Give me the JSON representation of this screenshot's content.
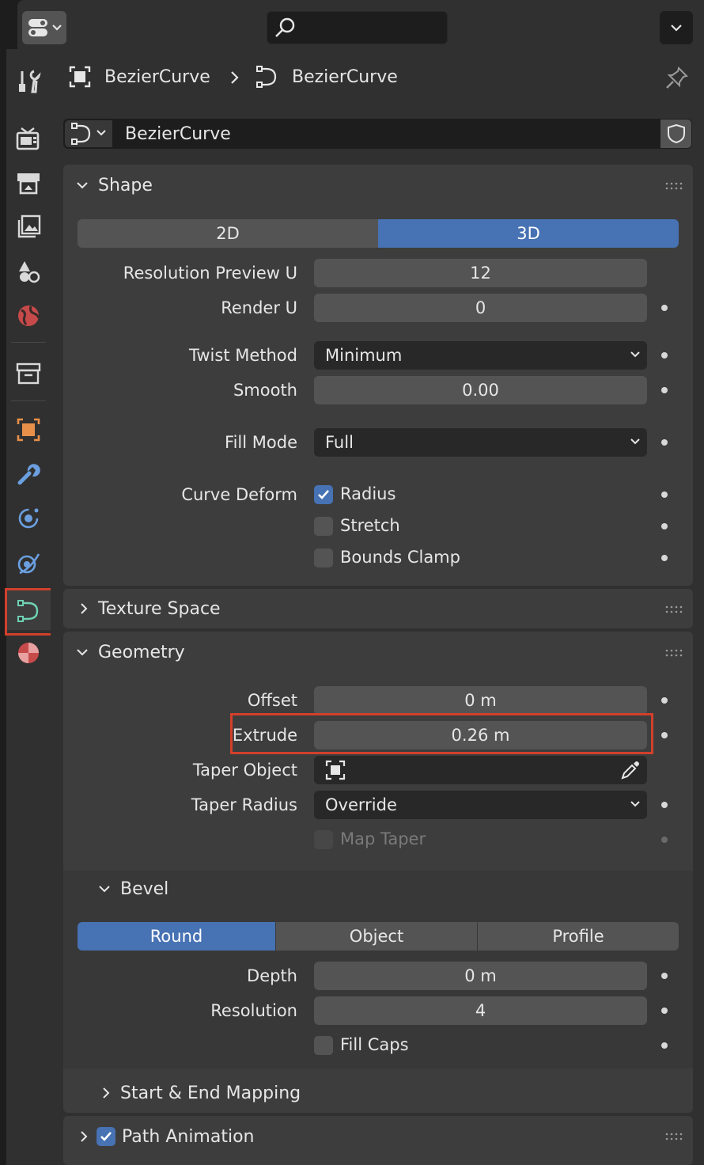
{
  "breadcrumb": {
    "object": "BezierCurve",
    "data": "BezierCurve"
  },
  "datablock": {
    "name": "BezierCurve"
  },
  "shape": {
    "title": "Shape",
    "dimension_options": [
      "2D",
      "3D"
    ],
    "resolution_preview_u": {
      "label": "Resolution Preview U",
      "value": "12"
    },
    "render_u": {
      "label": "Render U",
      "value": "0"
    },
    "twist_method": {
      "label": "Twist Method",
      "value": "Minimum"
    },
    "smooth": {
      "label": "Smooth",
      "value": "0.00"
    },
    "fill_mode": {
      "label": "Fill Mode",
      "value": "Full"
    },
    "curve_deform": {
      "label": "Curve Deform",
      "radius": "Radius",
      "stretch": "Stretch",
      "bounds_clamp": "Bounds Clamp"
    }
  },
  "texture_space": {
    "title": "Texture Space"
  },
  "geometry": {
    "title": "Geometry",
    "offset": {
      "label": "Offset",
      "value": "0 m"
    },
    "extrude": {
      "label": "Extrude",
      "value": "0.26 m"
    },
    "taper_object": {
      "label": "Taper Object"
    },
    "taper_radius": {
      "label": "Taper Radius",
      "value": "Override"
    },
    "map_taper": "Map Taper"
  },
  "bevel": {
    "title": "Bevel",
    "modes": [
      "Round",
      "Object",
      "Profile"
    ],
    "depth": {
      "label": "Depth",
      "value": "0 m"
    },
    "resolution": {
      "label": "Resolution",
      "value": "4"
    },
    "fill_caps": "Fill Caps"
  },
  "start_end_mapping": {
    "title": "Start & End Mapping"
  },
  "path_animation": {
    "title": "Path Animation"
  },
  "colors": {
    "accent": "#4772b3",
    "highlight": "#d2402b",
    "curve_green": "#6fd1b4"
  },
  "icons": {
    "sidebar": [
      "tool-icon",
      "render-icon",
      "output-icon",
      "view-layer-icon",
      "scene-icon",
      "world-icon",
      "collection-icon",
      "object-icon",
      "modifier-icon",
      "particles-icon",
      "physics-icon",
      "curve-data-icon",
      "material-icon"
    ]
  }
}
